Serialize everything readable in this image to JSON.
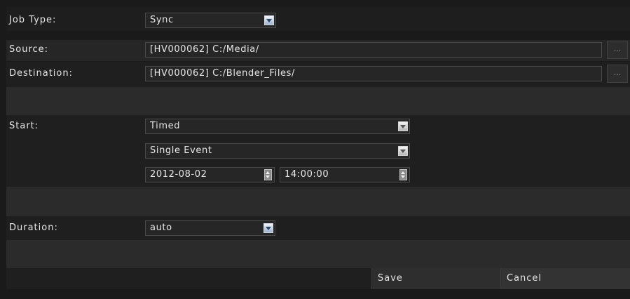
{
  "form": {
    "job_type": {
      "label": "Job Type:",
      "value": "Sync"
    },
    "source": {
      "label": "Source:",
      "value": "[HV000062] C:/Media/",
      "browse_label": "..."
    },
    "destination": {
      "label": "Destination:",
      "value": "[HV000062] C:/Blender_Files/",
      "browse_label": "..."
    },
    "start": {
      "label": "Start:",
      "mode": "Timed",
      "recurrence": "Single Event",
      "date": "2012-08-02",
      "time": "14:00:00"
    },
    "duration": {
      "label": "Duration:",
      "value": "auto"
    }
  },
  "actions": {
    "save_label": "Save",
    "cancel_label": "Cancel"
  },
  "colors": {
    "background": "#1a1a1a",
    "row_dark": "#1f1f1f",
    "row_light": "#282828",
    "field_border": "#4a4a4a",
    "dropdown_accent": "#9fb3d0"
  }
}
